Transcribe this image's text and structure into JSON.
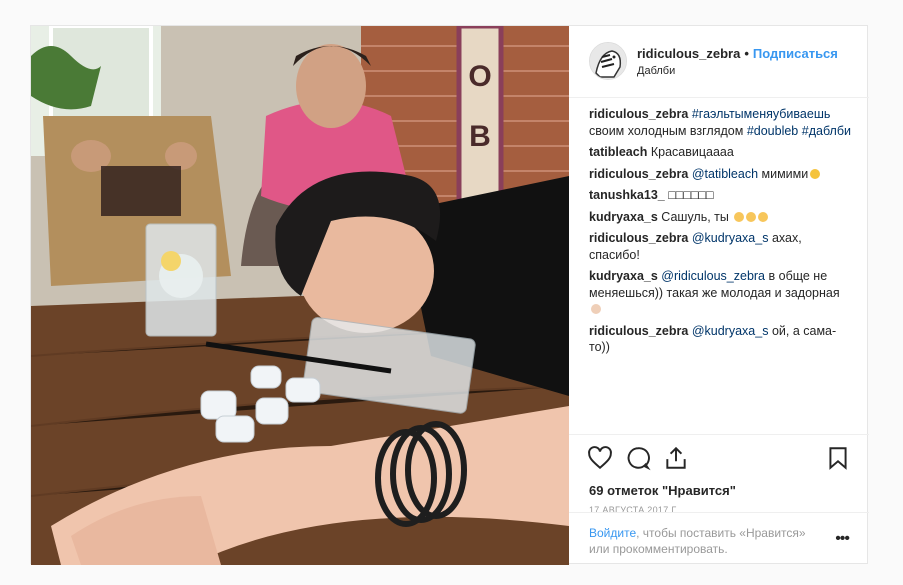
{
  "post": {
    "author": "ridiculous_zebra",
    "follow_label": "Подписаться",
    "location": "Даблби"
  },
  "comments": [
    {
      "user": "ridiculous_zebra",
      "text": "",
      "hashtags": "#гаэльтыменяубиваешь",
      "rest": "своим холодным взглядом",
      "tag2": "#doubleb",
      "tag3": "#даблби"
    },
    {
      "user": "tatibleach",
      "text": "Красавицаааа"
    },
    {
      "user": "ridiculous_zebra",
      "mention": "@tatibleach",
      "text": "мимими",
      "emoji": "smile"
    },
    {
      "user": "tanushka13_",
      "text": "□□□□□□"
    },
    {
      "user": "kudryaxa_s",
      "text": "Сашуль, ты",
      "emoji": "clap-x3"
    },
    {
      "user": "ridiculous_zebra",
      "mention": "@kudryaxa_s",
      "text": "ахах, спасибо!"
    },
    {
      "user": "kudryaxa_s",
      "mention": "@ridiculous_zebra",
      "text": "в обще не меняешься)) такая же молодая и задорная",
      "emoji": "point"
    },
    {
      "user": "ridiculous_zebra",
      "mention": "@kudryaxa_s",
      "text": "ой, а сама-то))"
    }
  ],
  "actions": {
    "likes": "69 отметок \"Нравится\"",
    "date": "17 АВГУСТА 2017 Г.",
    "icons": [
      "heart-icon",
      "comment-icon",
      "share-icon",
      "bookmark-icon"
    ]
  },
  "login": {
    "link": "Войдите",
    "text": ", чтобы поставить «Нравится» или прокомментировать.",
    "more": "•••"
  },
  "colors": {
    "link": "#003569",
    "accent": "#3897f0",
    "muted": "#999999"
  }
}
